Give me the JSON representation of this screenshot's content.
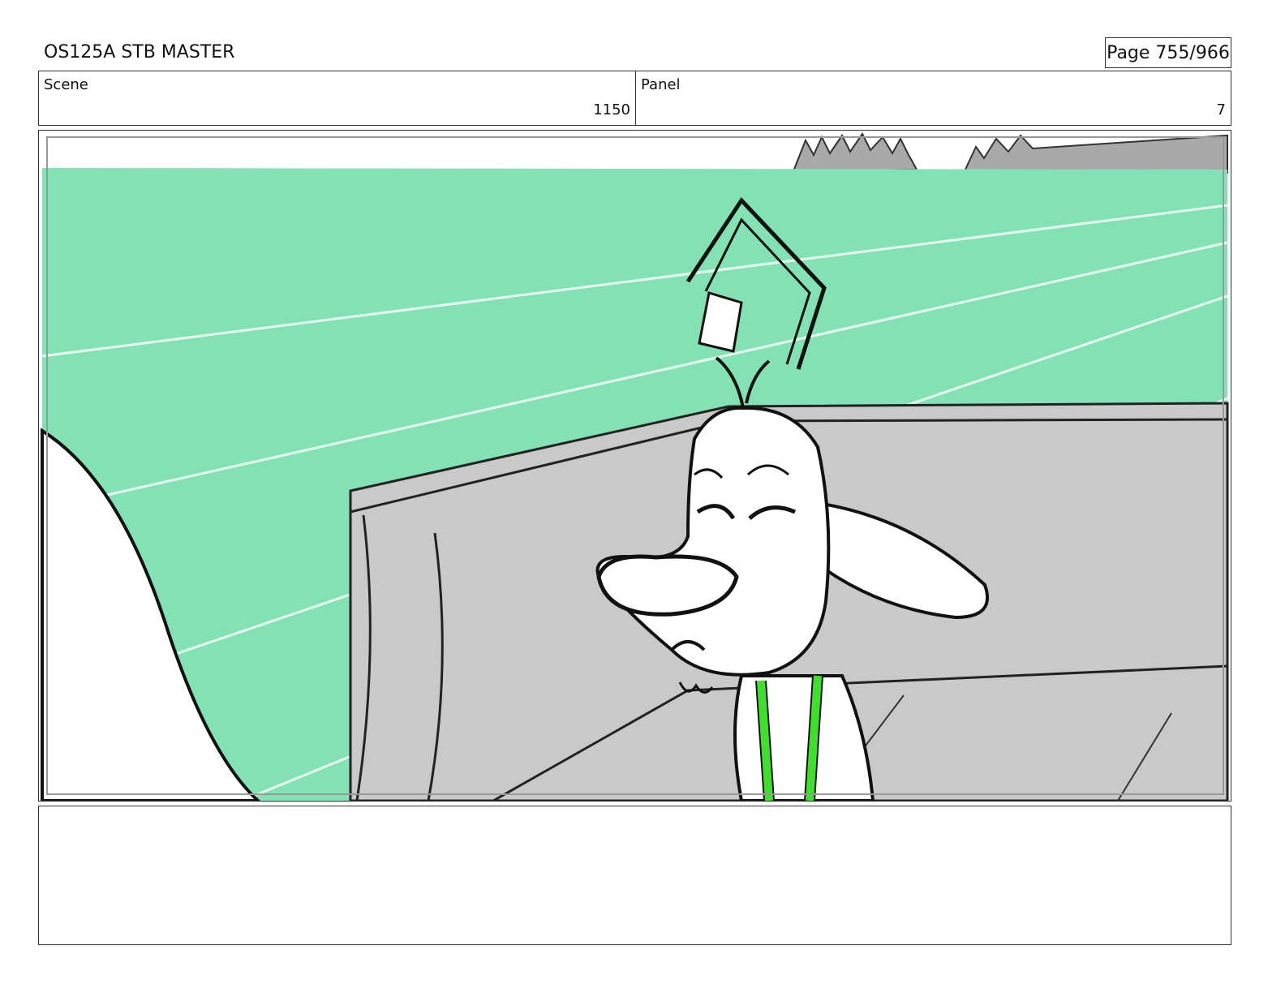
{
  "header": {
    "doc_title": "OS125A  STB MASTER",
    "page_label": "Page 755/966"
  },
  "scene": {
    "label": "Scene",
    "value": "1150"
  },
  "panel": {
    "label": "Panel",
    "value": "7"
  },
  "colors": {
    "screen_green": "#82e2b3",
    "wall_gray": "#c9c9c9",
    "suspender_green": "#3ee12a",
    "line": "#1a1a1a"
  },
  "notes": {
    "text": ""
  }
}
